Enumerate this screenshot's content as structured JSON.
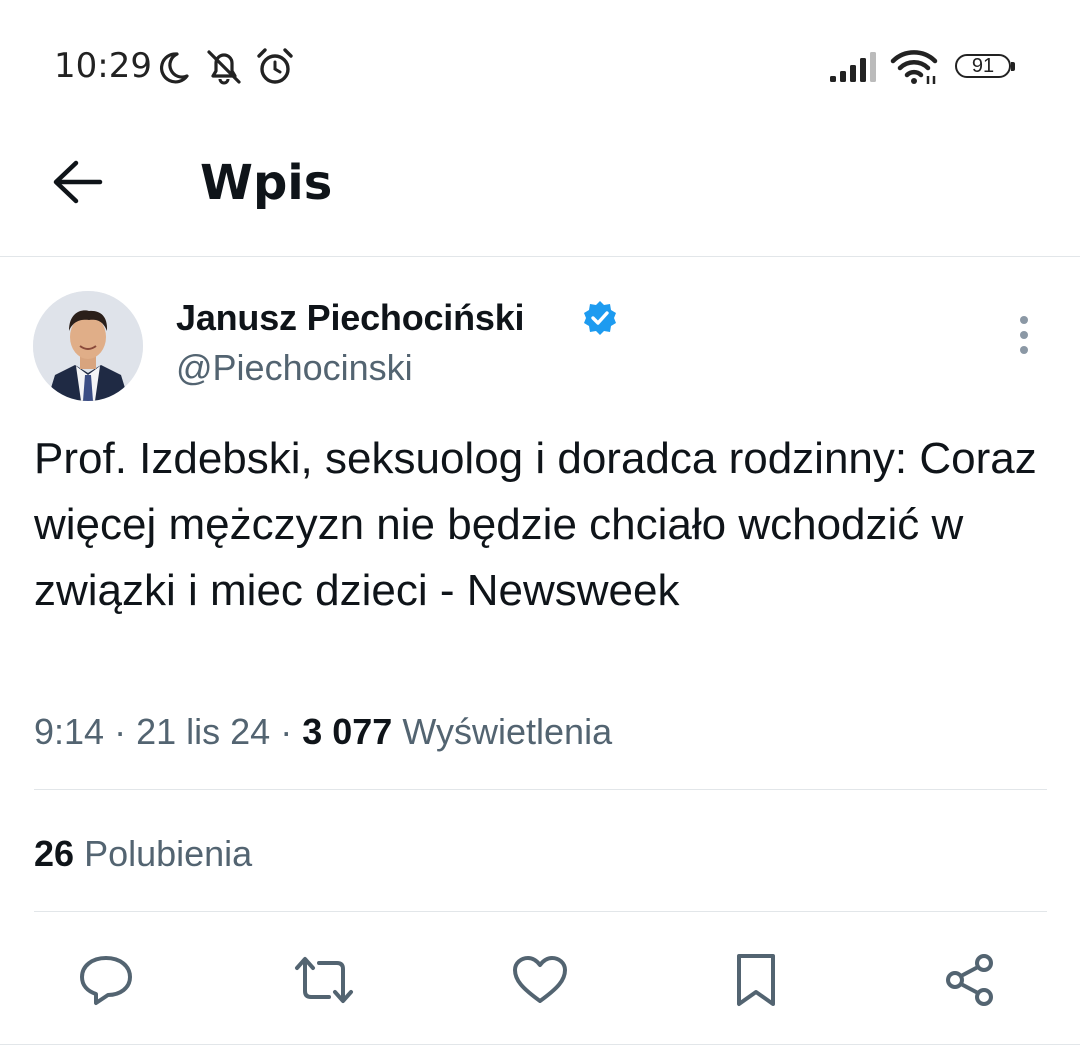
{
  "status_bar": {
    "time": "10:29",
    "battery": "91",
    "icons": [
      "moon-icon",
      "bell-off-icon",
      "alarm-icon",
      "signal-icon",
      "wifi-icon",
      "battery-icon"
    ]
  },
  "header": {
    "back_icon": "arrow-left-icon",
    "title": "Wpis"
  },
  "post": {
    "author_name": "Janusz Piechociński",
    "verified_icon": "verified-badge-icon",
    "handle": "@Piechocinski",
    "more_icon": "more-vertical-icon",
    "text": "Prof. Izdebski, seksuolog i doradca rodzinny: Coraz więcej mężczyzn nie będzie chciało wchodzić w związki i miec dzieci - Newsweek",
    "time": "9:14",
    "separator": "·",
    "date": "21 lis 24",
    "views_count": "3 077",
    "views_label": "Wyświetlenia",
    "likes_count": "26",
    "likes_label": "Polubienia"
  },
  "actions": [
    "reply-icon",
    "repost-icon",
    "like-icon",
    "bookmark-icon",
    "share-icon"
  ],
  "colors": {
    "text": "#0f1419",
    "secondary": "#536471",
    "verified": "#1d9bf0",
    "divider": "#e2e6e9"
  }
}
